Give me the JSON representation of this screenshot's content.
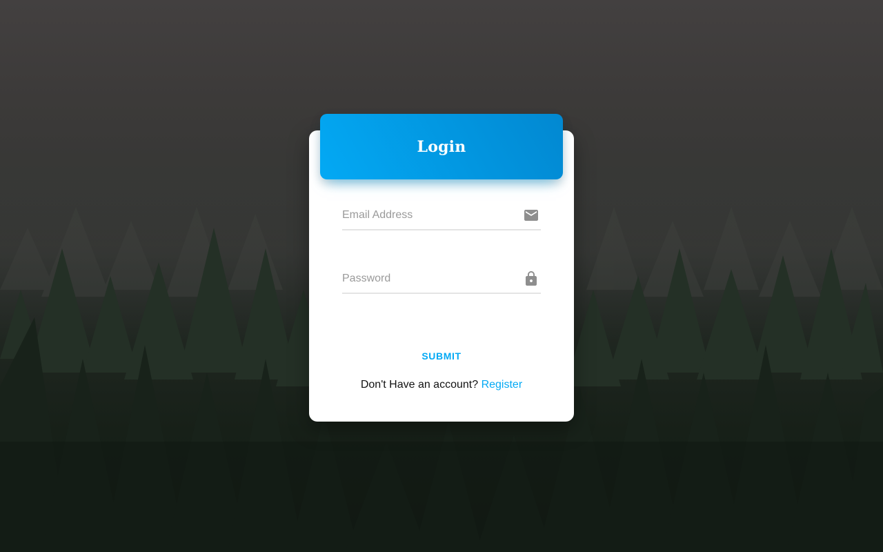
{
  "colors": {
    "accent": "#03a9f4",
    "accent_dark": "#0288d1",
    "card_bg": "#ffffff",
    "placeholder": "#9a9a9a",
    "icon": "#8e8e8e"
  },
  "login_card": {
    "title": "Login",
    "email": {
      "placeholder": "Email Address",
      "value": "",
      "icon": "mail-icon"
    },
    "password": {
      "placeholder": "Password",
      "value": "",
      "icon": "lock-icon"
    },
    "submit_label": "SUBMIT",
    "register_prompt": "Don't Have an account?",
    "register_link": "Register"
  }
}
